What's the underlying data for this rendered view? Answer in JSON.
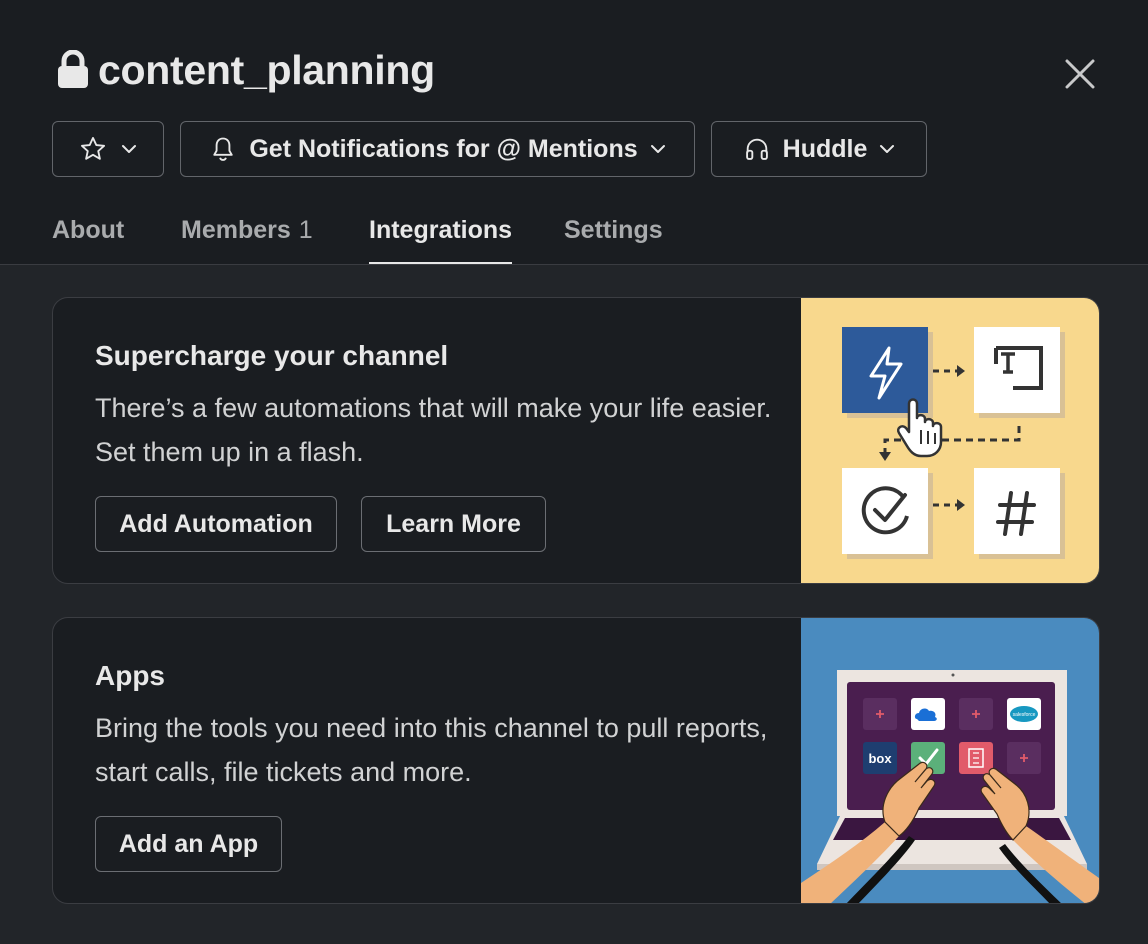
{
  "header": {
    "channel_name": "content_planning",
    "notifications_label": "Get Notifications for @ Mentions",
    "huddle_label": "Huddle"
  },
  "tabs": [
    {
      "label": "About"
    },
    {
      "label": "Members",
      "count": "1"
    },
    {
      "label": "Integrations",
      "active": true
    },
    {
      "label": "Settings"
    }
  ],
  "automation_card": {
    "title": "Supercharge your channel",
    "description": "There’s a few automations that will make your life easier. Set them up in a flash.",
    "primary_button": "Add Automation",
    "secondary_button": "Learn More"
  },
  "apps_card": {
    "title": "Apps",
    "description": "Bring the tools you need into this channel to pull reports, start calls, file tickets and more.",
    "button": "Add an App",
    "tile_labels": {
      "box": "box",
      "salesforce": "salesforce"
    }
  },
  "colors": {
    "background": "#1a1d21",
    "content_background": "#222529",
    "text_primary": "#e8e8e8",
    "text_secondary": "#a9abad",
    "automation_illustration_bg": "#f8d88d",
    "apps_illustration_bg": "#4a8bbf",
    "workflow_blue": "#2d5a9a",
    "laptop_purple": "#4a1e4f"
  },
  "icons": {
    "lock": "lock-icon",
    "close": "close-icon",
    "star": "star-icon",
    "chevron": "chevron-down-icon",
    "bell": "bell-icon",
    "headphones": "headphones-icon"
  }
}
